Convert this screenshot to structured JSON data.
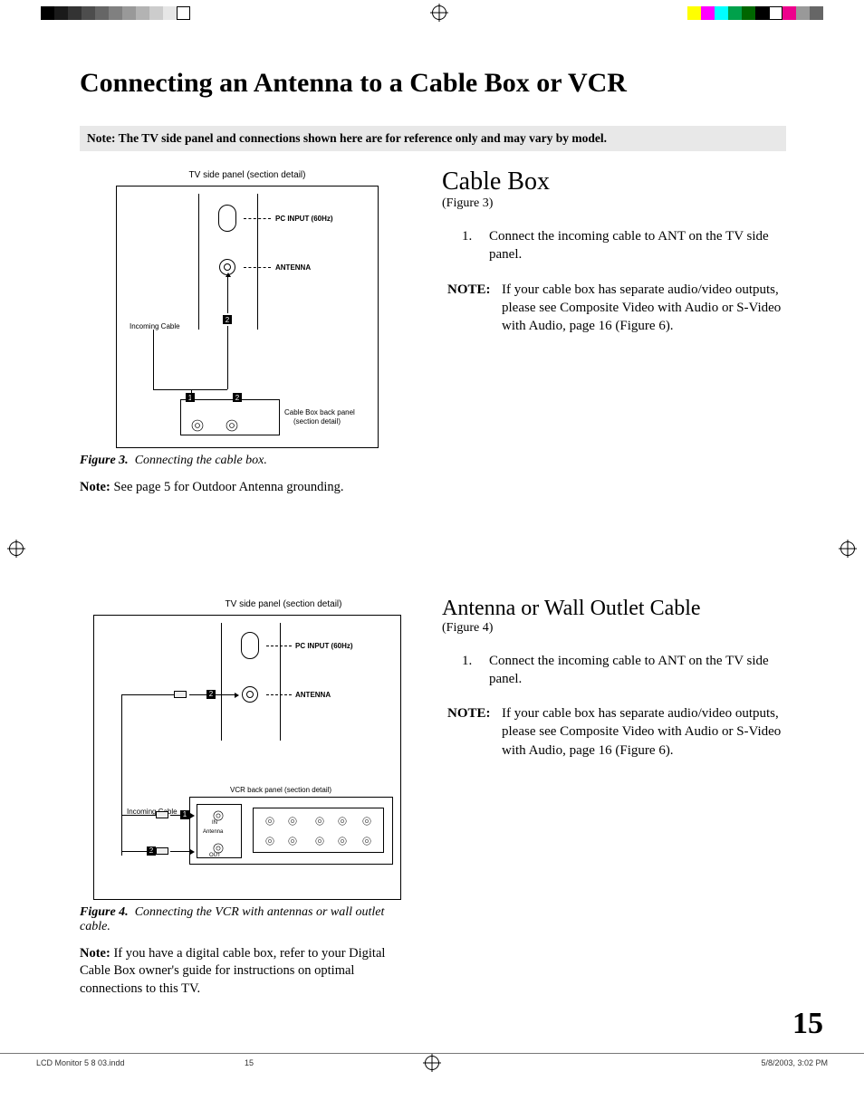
{
  "header": {
    "title": "Connecting an Antenna to a Cable Box or VCR",
    "top_note": "Note:  The TV side panel and connections shown here are for reference only and may vary by model."
  },
  "page_number": "15",
  "footer": {
    "filename": "LCD Monitor 5 8 03.indd",
    "page": "15",
    "datetime": "5/8/2003, 3:02 PM"
  },
  "section1": {
    "heading": "Cable Box",
    "figref": "(Figure 3)",
    "step1_num": "1.",
    "step1_text": "Connect the incoming cable to ANT on the TV side panel.",
    "note_label": "NOTE:",
    "note_text": "If your cable box has separate audio/video outputs, please see Composite Video with Audio or S-Video with Audio, page 16 (Figure 6).",
    "figcap_label": "Figure 3.",
    "figcap_text": "Connecting the cable box.",
    "belownote_label": "Note:",
    "belownote_text": "See page 5 for Outdoor Antenna grounding.",
    "diagram": {
      "tv_label": "TV side panel (section detail)",
      "pc_label": "PC INPUT (60Hz)",
      "ant_label": "ANTENNA",
      "incoming": "Incoming Cable",
      "cbox_label1": "Cable Box back panel",
      "cbox_label2": "(section detail)"
    }
  },
  "section2": {
    "heading": "Antenna or Wall Outlet Cable",
    "figref": "(Figure 4)",
    "step1_num": "1.",
    "step1_text": "Connect the incoming cable to ANT on the TV side panel.",
    "note_label": "NOTE:",
    "note_text": "If your cable box has separate audio/video outputs, please see Composite Video with Audio or S-Video with Audio, page 16 (Figure 6).",
    "figcap_label": "Figure 4.",
    "figcap_text": "Connecting the VCR with antennas or wall outlet cable.",
    "belownote_label": "Note:",
    "belownote_text": "If you have a digital cable box, refer to your Digital Cable Box owner's guide for  instructions on optimal connections to this TV.",
    "diagram": {
      "tv_label": "TV side panel (section detail)",
      "pc_label": "PC INPUT (60Hz)",
      "ant_label": "ANTENNA",
      "incoming": "Incoming Cable",
      "vcr_label": "VCR back panel (section detail)",
      "in_label": "IN",
      "ant_box_label": "Antenna",
      "out_label": "OUT"
    }
  }
}
